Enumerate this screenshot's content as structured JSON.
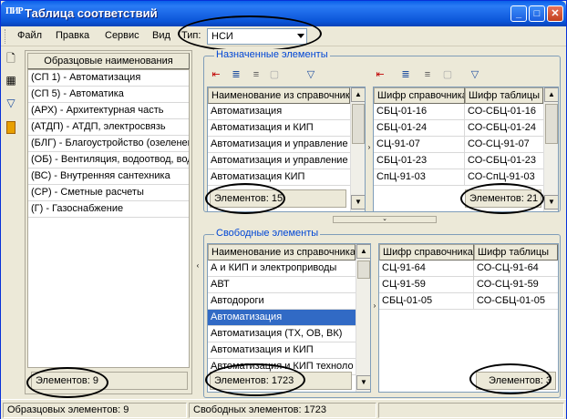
{
  "window": {
    "title": "Таблица соответствий",
    "app_icon": "ПИР"
  },
  "menu": {
    "items": [
      "Файл",
      "Правка",
      "Сервис",
      "Вид"
    ],
    "type_label": "Тип:",
    "type_value": "НСИ"
  },
  "reference_panel": {
    "header": "Образцовые наименования",
    "rows": [
      "(СП 1) - Автоматизация",
      "(СП 5) - Автоматика",
      "(АРХ) - Архитектурная часть",
      "(АТДП) - АТДП, электросвязь",
      "(БЛГ) - Благоустройство (озеленен",
      "(ОБ) - Вентиляция, водоотвод, вод",
      "(ВС) - Внутренняя сантехника",
      "(СР) - Сметные расчеты",
      "(Г) - Газоснабжение"
    ],
    "counter": "Элементов: 9"
  },
  "assigned": {
    "group_label": "Назначенные элементы",
    "left_header": "Наименование из справочник",
    "left_rows": [
      "Автоматизация",
      "Автоматизация и КИП",
      "Автоматизация и управление",
      "Автоматизация и управление",
      "Автоматизация КИП"
    ],
    "left_counter": "Элементов: 15",
    "right_headers": [
      "Шифр справочника",
      "Шифр таблицы"
    ],
    "right_rows": [
      [
        "СБЦ-01-16",
        "СО-СБЦ-01-16"
      ],
      [
        "СБЦ-01-24",
        "СО-СБЦ-01-24"
      ],
      [
        "СЦ-91-07",
        "СО-СЦ-91-07"
      ],
      [
        "СБЦ-01-23",
        "СО-СБЦ-01-23"
      ],
      [
        "СпЦ-91-03",
        "СО-СпЦ-91-03"
      ]
    ],
    "right_counter": "Элементов: 21"
  },
  "free": {
    "group_label": "Свободные элементы",
    "left_header": "Наименование из справочника",
    "left_rows": [
      "А и КИП и электроприводы",
      "АВТ",
      "Автодороги",
      "Автоматизация",
      "Автоматизация (ТХ, ОВ, ВК)",
      "Автоматизация и КИП",
      "Автоматизация и КИП техноло"
    ],
    "left_selected_index": 3,
    "left_counter": "Элементов: 1723",
    "right_headers": [
      "Шифр справочника",
      "Шифр таблицы"
    ],
    "right_rows": [
      [
        "СЦ-91-64",
        "СО-СЦ-91-64"
      ],
      [
        "СЦ-91-59",
        "СО-СЦ-91-59"
      ],
      [
        "СБЦ-01-05",
        "СО-СБЦ-01-05"
      ]
    ],
    "right_counter": "Элементов: 3"
  },
  "status": {
    "left": "Образцовых элементов: 9",
    "middle": "Свободных элементов: 1723"
  },
  "icons": {
    "left_toolbar": [
      "new-document-icon",
      "edit-table-icon",
      "filter-icon",
      "book-icon"
    ]
  },
  "colors": {
    "selection": "#316AC5",
    "titlebar": "#0A5FE8",
    "group_label": "#0046D5"
  }
}
